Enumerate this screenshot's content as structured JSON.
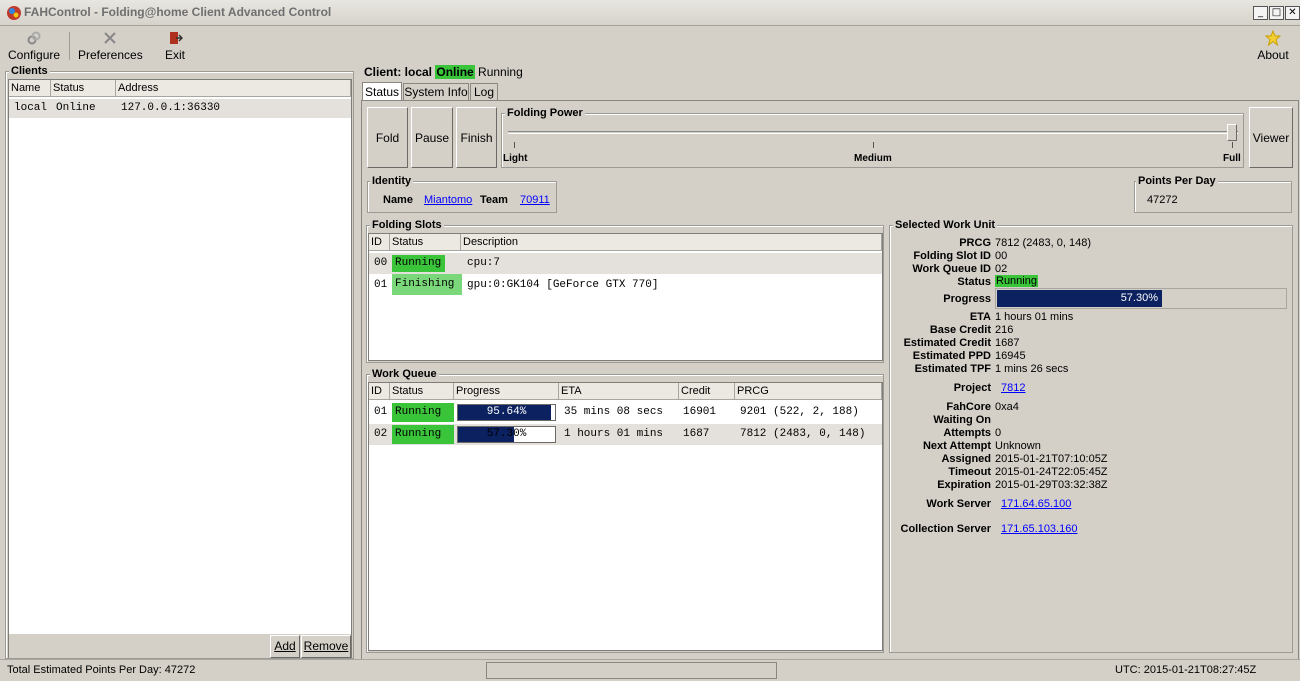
{
  "window": {
    "title": "FAHControl - Folding@home Client Advanced Control"
  },
  "toolbar": {
    "configure": "Configure",
    "preferences": "Preferences",
    "exit": "Exit",
    "about": "About"
  },
  "clients": {
    "title": "Clients",
    "columns": [
      "Name",
      "Status",
      "Address"
    ],
    "rows": [
      {
        "name": "local",
        "status": "Online",
        "address": "127.0.0.1:36330"
      }
    ],
    "add": "Add",
    "remove": "Remove"
  },
  "client_header": {
    "prefix": "Client: local",
    "online": "Online",
    "state": "Running"
  },
  "tabs": [
    "Status",
    "System Info",
    "Log"
  ],
  "controls": {
    "fold": "Fold",
    "pause": "Pause",
    "finish": "Finish",
    "viewer": "Viewer"
  },
  "power": {
    "title": "Folding Power",
    "light": "Light",
    "medium": "Medium",
    "full": "Full"
  },
  "identity": {
    "title": "Identity",
    "name_label": "Name",
    "name": "Miantomo",
    "team_label": "Team",
    "team": "70911"
  },
  "ppd": {
    "title": "Points Per Day",
    "value": "47272"
  },
  "slots": {
    "title": "Folding Slots",
    "columns": [
      "ID",
      "Status",
      "Description"
    ],
    "rows": [
      {
        "id": "00",
        "status": "Running",
        "desc": "cpu:7"
      },
      {
        "id": "01",
        "status": "Finishing",
        "desc": "gpu:0:GK104 [GeForce GTX 770]"
      }
    ]
  },
  "queue": {
    "title": "Work Queue",
    "columns": [
      "ID",
      "Status",
      "Progress",
      "ETA",
      "Credit",
      "PRCG"
    ],
    "rows": [
      {
        "id": "01",
        "status": "Running",
        "progress": "95.64%",
        "progress_frac": 0.9564,
        "eta": "35 mins 08 secs",
        "credit": "16901",
        "prcg": "9201 (522, 2, 188)"
      },
      {
        "id": "02",
        "status": "Running",
        "progress": "57.30%",
        "progress_frac": 0.573,
        "eta": "1 hours 01 mins",
        "credit": "1687",
        "prcg": "7812 (2483, 0, 148)"
      }
    ]
  },
  "selected": {
    "title": "Selected Work Unit",
    "prcg_label": "PRCG",
    "prcg": "7812 (2483, 0, 148)",
    "slot_label": "Folding Slot ID",
    "slot": "00",
    "queue_label": "Work Queue ID",
    "queue": "02",
    "status_label": "Status",
    "status": "Running",
    "progress_label": "Progress",
    "progress": "57.30%",
    "progress_frac": 0.573,
    "eta_label": "ETA",
    "eta": "1 hours 01 mins",
    "base_label": "Base Credit",
    "base": "216",
    "est_credit_label": "Estimated Credit",
    "est_credit": "1687",
    "est_ppd_label": "Estimated PPD",
    "est_ppd": "16945",
    "est_tpf_label": "Estimated TPF",
    "est_tpf": "1 mins 26 secs",
    "project_label": "Project",
    "project": "7812",
    "fahcore_label": "FahCore",
    "fahcore": "0xa4",
    "waiting_label": "Waiting On",
    "waiting": "",
    "attempts_label": "Attempts",
    "attempts": "0",
    "next_label": "Next Attempt",
    "next": "Unknown",
    "assigned_label": "Assigned",
    "assigned": "2015-01-21T07:10:05Z",
    "timeout_label": "Timeout",
    "timeout": "2015-01-24T22:05:45Z",
    "expiration_label": "Expiration",
    "expiration": "2015-01-29T03:32:38Z",
    "ws_label": "Work Server",
    "ws": "171.64.65.100",
    "cs_label": "Collection Server",
    "cs": "171.65.103.160"
  },
  "statusbar": {
    "left": "Total Estimated Points Per Day: 47272",
    "right": "UTC: 2015-01-21T08:27:45Z"
  }
}
